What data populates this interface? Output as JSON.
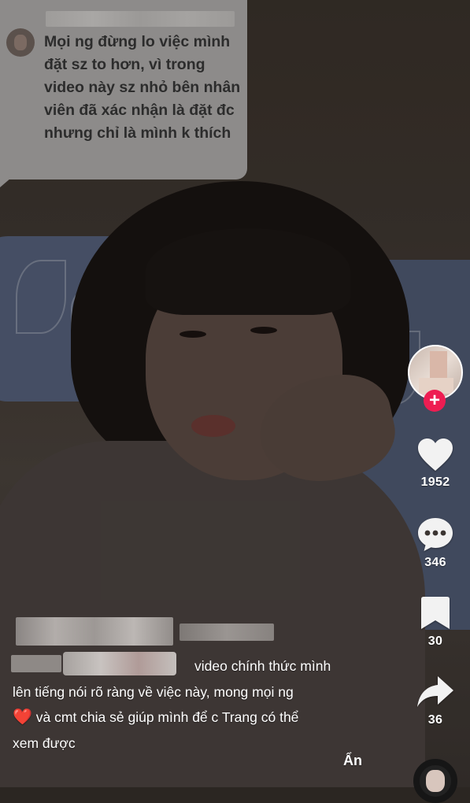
{
  "comment_bubble": {
    "text": "Mọi ng đừng lo việc mình đặt sz to hơn, vì trong video này sz nhỏ bên nhân viên đã xác nhận là đặt đc nhưng chỉ là mình k thích"
  },
  "actions": {
    "likes": "1952",
    "comments": "346",
    "saves": "30",
    "shares": "36"
  },
  "caption": {
    "line1": "video chính thức mình",
    "line2": "lên tiếng nói rõ ràng về việc này, mong mọi ng",
    "heart": "❤️",
    "line3": " và cmt chia sẻ giúp mình để c Trang có thể",
    "line4": "xem được",
    "hide_label": "Ẩn"
  },
  "icons": {
    "like": "heart-icon",
    "comment": "comment-bubble-icon",
    "save": "bookmark-icon",
    "share": "share-arrow-icon",
    "follow": "plus-icon"
  },
  "colors": {
    "follow_badge": "#ee1d52",
    "comment_bubble": "#8d8b8a"
  }
}
